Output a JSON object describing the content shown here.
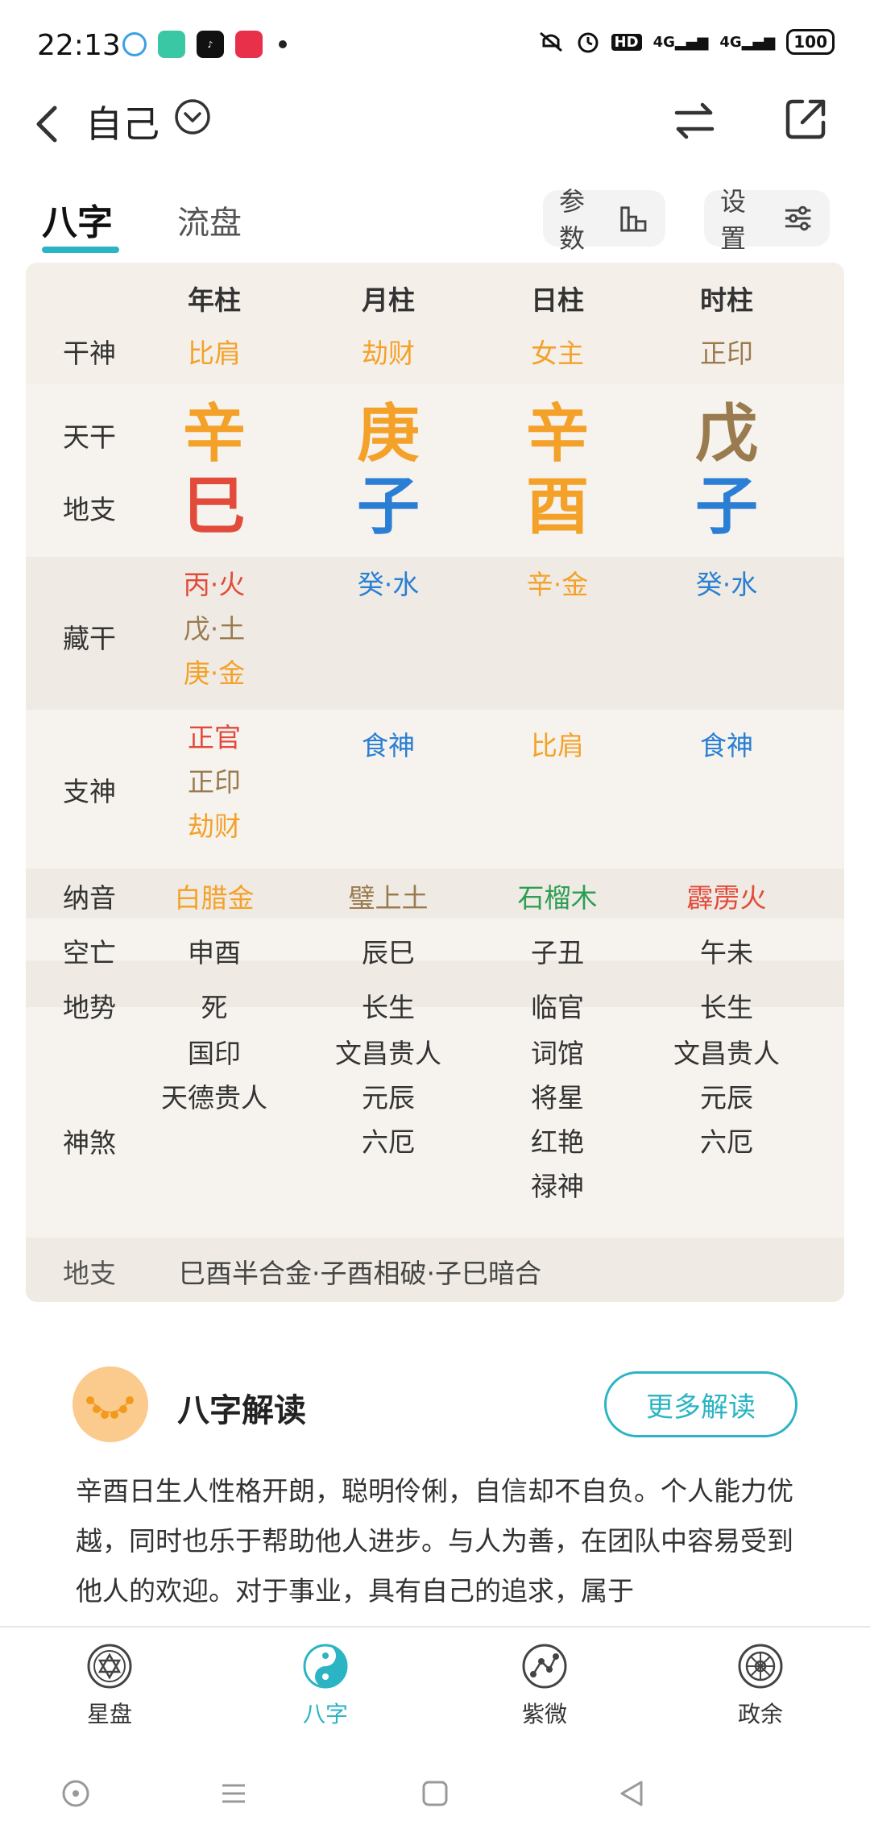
{
  "status_bar": {
    "time": "22:13",
    "network_1": "4G",
    "network_2": "4G",
    "battery": "100",
    "hd_label": "HD"
  },
  "header": {
    "title": "自己"
  },
  "tabs": [
    {
      "label": "八字",
      "active": true
    },
    {
      "label": "流盘",
      "active": false
    }
  ],
  "toolbar": {
    "params_label": "参数",
    "settings_label": "设置"
  },
  "colors": {
    "accent": "#2bb4c4",
    "wood": "#2e9e55",
    "fire": "#e24a3b",
    "earth": "#9a7b4f",
    "metal": "#f4a12a",
    "water": "#2a7fd4"
  },
  "chart": {
    "columns": [
      "年柱",
      "月柱",
      "日柱",
      "时柱"
    ],
    "labels": {
      "gan_shen": "干神",
      "tian_gan": "天干",
      "di_zhi": "地支",
      "cang_gan": "藏干",
      "zhi_shen": "支神",
      "na_yin": "纳音",
      "kong_wang": "空亡",
      "di_shi": "地势",
      "shen_sha": "神煞",
      "di_zhi_relation": "地支"
    },
    "gan_shen": [
      "比肩",
      "劫财",
      "女主",
      "正印"
    ],
    "tian_gan": [
      "辛",
      "庚",
      "辛",
      "戊"
    ],
    "di_zhi": [
      "巳",
      "子",
      "酉",
      "子"
    ],
    "cang_gan": [
      [
        "丙·火",
        "戊·土",
        "庚·金"
      ],
      [
        "癸·水"
      ],
      [
        "辛·金"
      ],
      [
        "癸·水"
      ]
    ],
    "zhi_shen": [
      [
        "正官",
        "正印",
        "劫财"
      ],
      [
        "食神"
      ],
      [
        "比肩"
      ],
      [
        "食神"
      ]
    ],
    "na_yin": [
      "白腊金",
      "璧上土",
      "石榴木",
      "霹雳火"
    ],
    "kong_wang": [
      "申酉",
      "辰巳",
      "子丑",
      "午未"
    ],
    "di_shi": [
      "死",
      "长生",
      "临官",
      "长生"
    ],
    "shen_sha": [
      [
        "国印",
        "天德贵人"
      ],
      [
        "文昌贵人",
        "元辰",
        "六厄"
      ],
      [
        "词馆",
        "将星",
        "红艳",
        "禄神"
      ],
      [
        "文昌贵人",
        "元辰",
        "六厄"
      ]
    ],
    "di_zhi_relation_text": "巳酉半合金·子酉相破·子巳暗合"
  },
  "reading": {
    "title": "八字解读",
    "more_label": "更多解读",
    "text": "辛酉日生人性格开朗，聪明伶俐，自信却不自负。个人能力优越，同时也乐于帮助他人进步。与人为善，在团队中容易受到他人的欢迎。对于事业，具有自己的追求，属于"
  },
  "bottom_nav": [
    {
      "label": "星盘",
      "icon": "star-of-david-icon"
    },
    {
      "label": "八字",
      "icon": "yin-yang-icon",
      "active": true
    },
    {
      "label": "紫微",
      "icon": "constellation-icon"
    },
    {
      "label": "政余",
      "icon": "dharma-wheel-icon"
    }
  ]
}
